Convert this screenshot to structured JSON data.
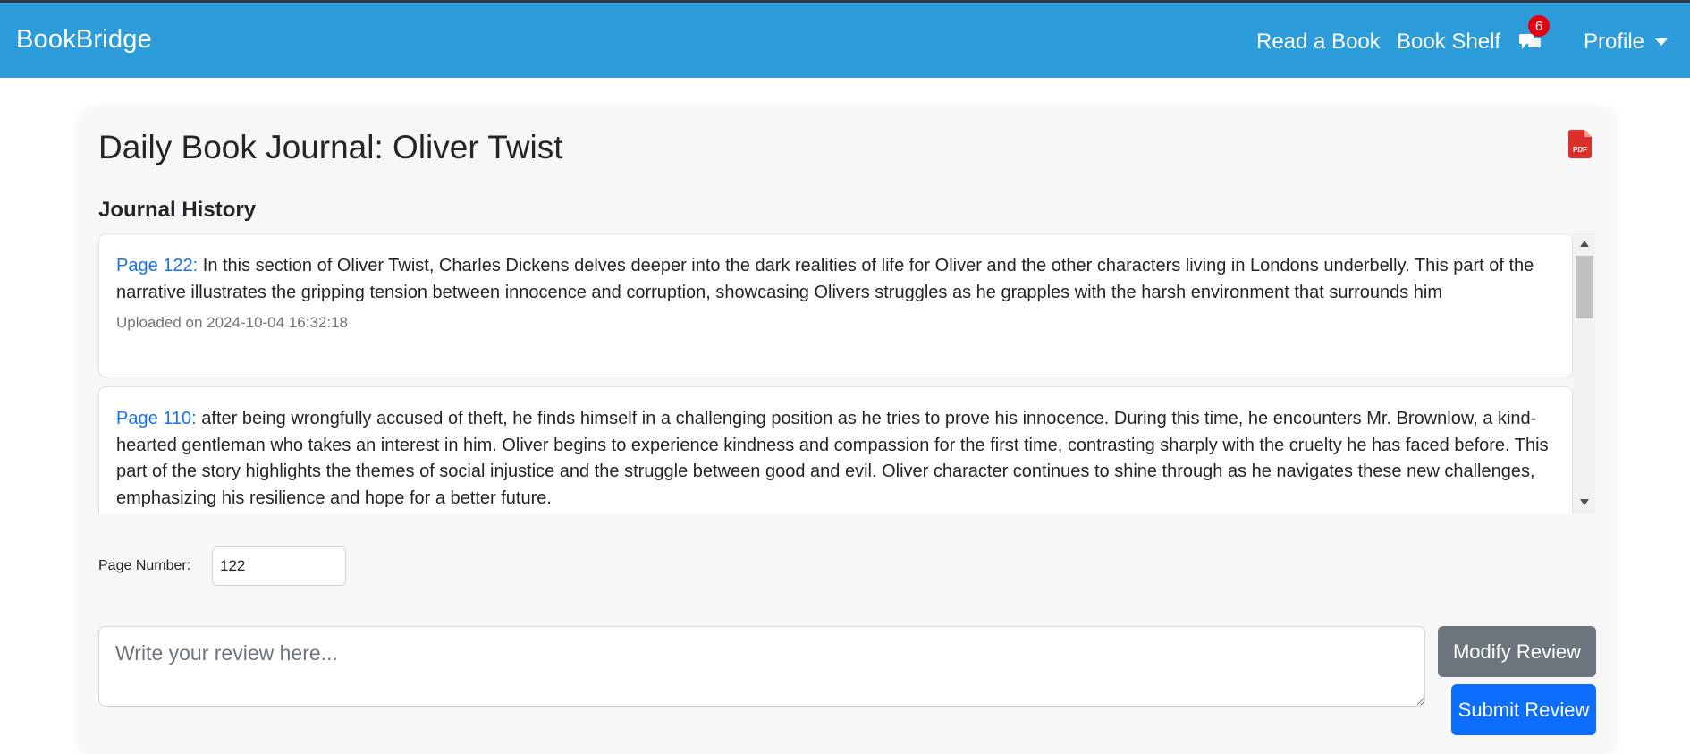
{
  "navbar": {
    "brand": "BookBridge",
    "links": [
      "Read a Book",
      "Book Shelf"
    ],
    "messages_badge": "6",
    "profile_label": "Profile",
    "color": "#2d9cdb"
  },
  "journal": {
    "title": "Daily Book Journal: Oliver Twist",
    "export_icon": "pdf-file-icon",
    "history_label": "Journal History",
    "entries": [
      {
        "page_label": "Page 122:",
        "text": " In this section of Oliver Twist, Charles Dickens delves deeper into the dark realities of life for Oliver and the other characters living in Londons underbelly. This part of the narrative illustrates the gripping tension between innocence and corruption, showcasing Olivers struggles as he grapples with the harsh environment that surrounds him",
        "uploaded": "Uploaded on 2024-10-04 16:32:18"
      },
      {
        "page_label": "Page 110:",
        "text": " after being wrongfully accused of theft, he finds himself in a challenging position as he tries to prove his innocence. During this time, he encounters Mr. Brownlow, a kind-hearted gentleman who takes an interest in him. Oliver begins to experience kindness and compassion for the first time, contrasting sharply with the cruelty he has faced before. This part of the story highlights the themes of social injustice and the struggle between good and evil. Oliver character continues to shine through as he navigates these new challenges, emphasizing his resilience and hope for a better future.",
        "uploaded": ""
      }
    ]
  },
  "form": {
    "page_number_label": "Page Number:",
    "page_number_value": "122",
    "review_placeholder": "Write your review here...",
    "modify_label": "Modify Review",
    "submit_label": "Submit Review"
  }
}
